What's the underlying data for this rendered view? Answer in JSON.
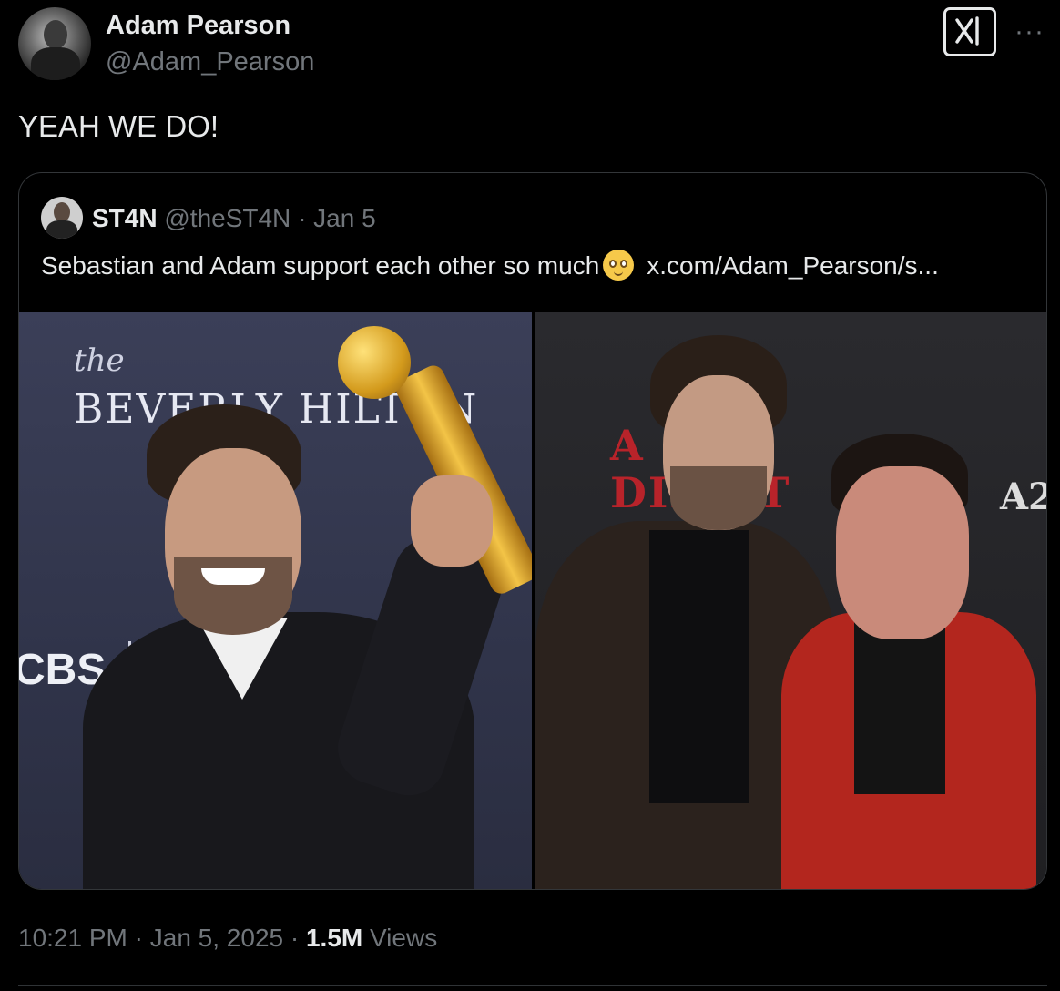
{
  "author": {
    "display_name": "Adam Pearson",
    "handle": "@Adam_Pearson"
  },
  "post": {
    "text": "YEAH WE DO!"
  },
  "quoted_post": {
    "name": "ST4N",
    "handle": "@theST4N",
    "separator": "·",
    "date": "Jan 5",
    "text": "Sebastian and Adam support each other so much",
    "emoji": "smiling-face-with-tear-emoji",
    "link": "x.com/Adam_Pearson/s...",
    "photo_left": {
      "the": "the",
      "venue": "BEVERLY HILTON",
      "network": "CBS"
    },
    "photo_right": {
      "poster_a": "A",
      "poster_word": "DIF    NT",
      "poster_brand": "A2"
    }
  },
  "meta": {
    "time": "10:21 PM",
    "separator1": " · ",
    "date": "Jan 5, 2025",
    "separator2": " · ",
    "views_count": "1.5M",
    "views_label": " Views"
  },
  "icons": {
    "grok": "grok-icon",
    "more": "more-icon"
  },
  "colors": {
    "background": "#000000",
    "primary_text": "#e7e9ea",
    "secondary_text": "#71767b",
    "border": "#333639"
  }
}
